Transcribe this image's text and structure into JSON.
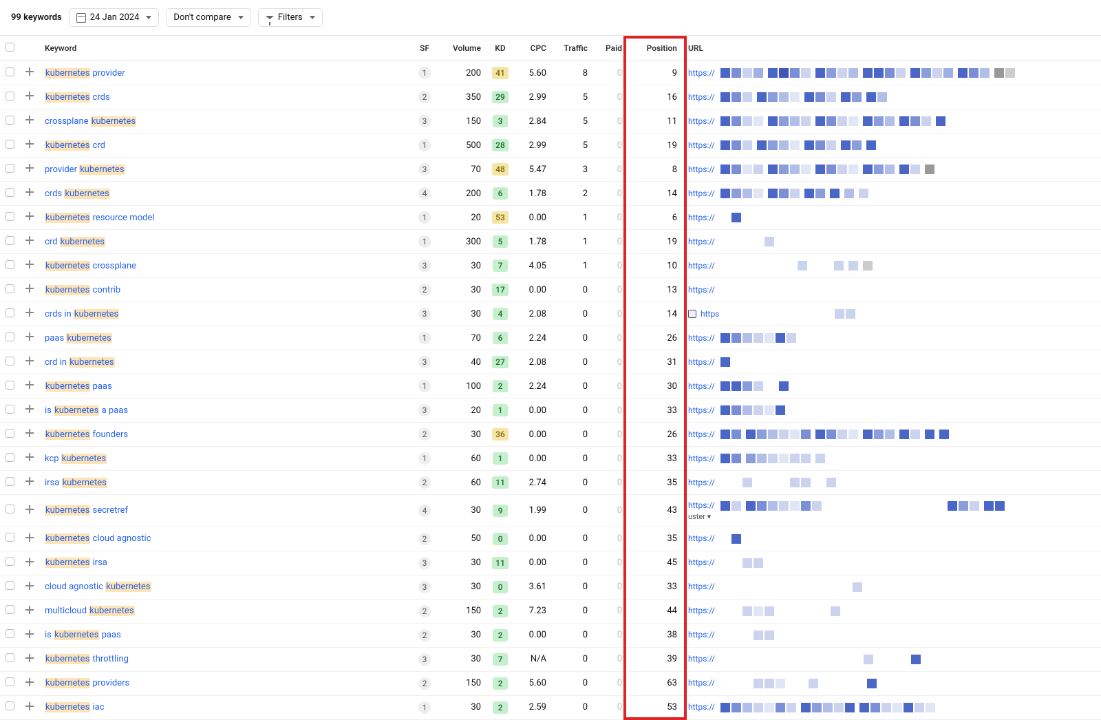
{
  "toolbar": {
    "count": "99 keywords",
    "date": "24 Jan 2024",
    "compare": "Don't compare",
    "filters": "Filters"
  },
  "headers": {
    "keyword": "Keyword",
    "sf": "SF",
    "volume": "Volume",
    "kd": "KD",
    "cpc": "CPC",
    "traffic": "Traffic",
    "paid": "Paid",
    "position": "Position",
    "url": "URL"
  },
  "highlight_term": "kubernetes",
  "rows": [
    {
      "kw": "kubernetes provider",
      "sf": 1,
      "volume": 200,
      "kd": 41,
      "cpc": "5.60",
      "traffic": 8,
      "paid": 0,
      "position": 9,
      "url": "https://",
      "blocks": [
        [
          "#4a66c7",
          "#7a8fd8",
          "#cbd3ef",
          "#9fb0e3"
        ],
        [
          "#4a66c7",
          "#3f57b8",
          "#7a8fd8",
          "#cbd3ef"
        ],
        [
          "#4a66c7",
          "#8b9ddd",
          "#cbd3ef",
          "#b1bfe8"
        ],
        [
          "#4a66c7",
          "#4a66c7",
          "#7a8fd8",
          "#cbd3ef"
        ],
        [
          "#4a66c7",
          "#8b9ddd",
          "#cbd3ef",
          "#9fb0e3"
        ],
        [
          "#4a66c7",
          "#7a8fd8",
          "#b1bfe8"
        ],
        [
          "#999",
          "#ccc"
        ]
      ]
    },
    {
      "kw": "kubernetes crds",
      "sf": 2,
      "volume": 350,
      "kd": 29,
      "cpc": "2.99",
      "traffic": 5,
      "paid": 0,
      "position": 16,
      "url": "https://",
      "blocks": [
        [
          "#4a66c7",
          "#7a8fd8",
          "#cbd3ef"
        ],
        [
          "#4a66c7",
          "#8b9ddd",
          "#b1bfe8",
          "#e1e6f6"
        ],
        [
          "#4a66c7",
          "#7a8fd8",
          "#cbd3ef"
        ],
        [
          "#4a66c7",
          "#8b9ddd"
        ],
        [
          "#4a66c7",
          "#b1bfe8"
        ]
      ]
    },
    {
      "kw": "crossplane kubernetes",
      "sf": 3,
      "volume": 150,
      "kd": 3,
      "cpc": "2.84",
      "traffic": 5,
      "paid": 0,
      "position": 11,
      "url": "https://",
      "blocks": [
        [
          "#4a66c7",
          "#7a8fd8",
          "#cbd3ef",
          "#e1e6f6"
        ],
        [
          "#4a66c7",
          "#8b9ddd",
          "#b1bfe8",
          "#cbd3ef"
        ],
        [
          "#4a66c7",
          "#7a8fd8",
          "#cbd3ef",
          "#e1e6f6"
        ],
        [
          "#4a66c7",
          "#8b9ddd",
          "#b1bfe8"
        ],
        [
          "#4a66c7",
          "#7a8fd8",
          "#cbd3ef"
        ],
        [
          "#4a66c7"
        ]
      ]
    },
    {
      "kw": "kubernetes crd",
      "sf": 1,
      "volume": 500,
      "kd": 28,
      "cpc": "2.99",
      "traffic": 5,
      "paid": 0,
      "position": 19,
      "url": "https://",
      "blocks": [
        [
          "#4a66c7",
          "#7a8fd8",
          "#cbd3ef"
        ],
        [
          "#4a66c7",
          "#8b9ddd",
          "#b1bfe8",
          "#e1e6f6"
        ],
        [
          "#4a66c7",
          "#7a8fd8",
          "#cbd3ef"
        ],
        [
          "#4a66c7",
          "#8b9ddd"
        ],
        [
          "#4a66c7"
        ]
      ]
    },
    {
      "kw": "provider kubernetes",
      "sf": 3,
      "volume": 70,
      "kd": 48,
      "cpc": "5.47",
      "traffic": 3,
      "paid": 0,
      "position": 8,
      "url": "https://",
      "blocks": [
        [
          "#4a66c7",
          "#7a8fd8",
          "#e1e6f6",
          "#cbd3ef"
        ],
        [
          "#4a66c7",
          "#8b9ddd",
          "#b1bfe8",
          "#e1e6f6"
        ],
        [
          "#4a66c7",
          "#7a8fd8",
          "#cbd3ef",
          "#e1e6f6"
        ],
        [
          "#4a66c7",
          "#8b9ddd",
          "#b1bfe8"
        ],
        [
          "#4a66c7",
          "#cbd3ef"
        ],
        [
          "#999"
        ]
      ]
    },
    {
      "kw": "crds kubernetes",
      "sf": 4,
      "volume": 200,
      "kd": 6,
      "cpc": "1.78",
      "traffic": 2,
      "paid": 0,
      "position": 14,
      "url": "https://",
      "blocks": [
        [
          "#4a66c7",
          "#8b9ddd",
          "#b1bfe8",
          "#e1e6f6"
        ],
        [
          "#4a66c7",
          "#7a8fd8",
          "#cbd3ef"
        ],
        [
          "#4a66c7",
          "#8b9ddd"
        ],
        [
          "#4a66c7"
        ],
        [
          "#b1bfe8"
        ],
        [
          "#cbd3ef"
        ]
      ]
    },
    {
      "kw": "kubernetes resource model",
      "sf": 1,
      "volume": 20,
      "kd": 53,
      "cpc": "0.00",
      "traffic": 1,
      "paid": 0,
      "position": 6,
      "url": "https://",
      "blocks": [
        [
          "",
          "#4a66c7"
        ]
      ]
    },
    {
      "kw": "crd kubernetes",
      "sf": 1,
      "volume": 300,
      "kd": 5,
      "cpc": "1.78",
      "traffic": 1,
      "paid": 0,
      "position": 19,
      "url": "https://",
      "blocks": [
        [
          "",
          "",
          "",
          "",
          "#cbd3ef"
        ]
      ]
    },
    {
      "kw": "kubernetes crossplane",
      "sf": 3,
      "volume": 30,
      "kd": 7,
      "cpc": "4.05",
      "traffic": 1,
      "paid": 0,
      "position": 10,
      "url": "https://",
      "blocks": [
        [
          "",
          "",
          "",
          "",
          "",
          "",
          "",
          "#cbd3ef"
        ],
        [
          "",
          "",
          "#cbd3ef"
        ],
        [
          "#cbd3ef"
        ],
        [
          "#ccc"
        ]
      ]
    },
    {
      "kw": "kubernetes contrib",
      "sf": 2,
      "volume": 30,
      "kd": 17,
      "cpc": "0.00",
      "traffic": 0,
      "paid": 0,
      "position": 13,
      "url": "https://",
      "blocks": []
    },
    {
      "kw": "crds in kubernetes",
      "sf": 3,
      "volume": 30,
      "kd": 4,
      "cpc": "2.08",
      "traffic": 0,
      "paid": 0,
      "position": 14,
      "url": "https",
      "ext_icon": true,
      "blocks": [
        [
          "",
          "",
          "",
          "",
          "",
          "",
          "",
          "",
          "",
          "",
          "#cbd3ef",
          "#cbd3ef"
        ]
      ]
    },
    {
      "kw": "paas kubernetes",
      "sf": 1,
      "volume": 70,
      "kd": 6,
      "cpc": "2.24",
      "traffic": 0,
      "paid": 0,
      "position": 26,
      "url": "https://",
      "blocks": [
        [
          "#4a66c7",
          "#7a8fd8",
          "#b1bfe8",
          "#cbd3ef",
          "#e1e6f6",
          "#4a66c7",
          "#cbd3ef"
        ]
      ]
    },
    {
      "kw": "crd in kubernetes",
      "sf": 3,
      "volume": 40,
      "kd": 27,
      "cpc": "2.08",
      "traffic": 0,
      "paid": 0,
      "position": 31,
      "url": "https://",
      "blocks": [
        [
          "#4a66c7"
        ]
      ]
    },
    {
      "kw": "kubernetes paas",
      "sf": 1,
      "volume": 100,
      "kd": 2,
      "cpc": "2.24",
      "traffic": 0,
      "paid": 0,
      "position": 30,
      "url": "https://",
      "blocks": [
        [
          "#4a66c7",
          "#4a66c7",
          "#8b9ddd",
          "#cbd3ef"
        ],
        [
          "",
          "#4a66c7"
        ]
      ]
    },
    {
      "kw": "is kubernetes a paas",
      "sf": 3,
      "volume": 20,
      "kd": 1,
      "cpc": "0.00",
      "traffic": 0,
      "paid": 0,
      "position": 33,
      "url": "https://",
      "blocks": [
        [
          "#4a66c7",
          "#7a8fd8",
          "#b1bfe8",
          "#cbd3ef",
          "#e1e6f6",
          "#4a66c7"
        ]
      ]
    },
    {
      "kw": "kubernetes founders",
      "sf": 2,
      "volume": 30,
      "kd": 36,
      "cpc": "0.00",
      "traffic": 0,
      "paid": 0,
      "position": 26,
      "url": "https://",
      "blocks": [
        [
          "#4a66c7",
          "#7a8fd8"
        ],
        [
          "#4a66c7",
          "#8b9ddd",
          "#b1bfe8",
          "#cbd3ef",
          "#e1e6f6",
          "#7a8fd8"
        ],
        [
          "#4a66c7",
          "#7a8fd8",
          "#cbd3ef",
          "#e1e6f6"
        ],
        [
          "#4a66c7",
          "#8b9ddd",
          "#b1bfe8"
        ],
        [
          "#4a66c7",
          "#cbd3ef"
        ],
        [
          "#4a66c7"
        ],
        [
          "#4a66c7"
        ]
      ]
    },
    {
      "kw": "kcp kubernetes",
      "sf": 1,
      "volume": 60,
      "kd": 1,
      "cpc": "0.00",
      "traffic": 0,
      "paid": 0,
      "position": 33,
      "url": "https://",
      "blocks": [
        [
          "#4a66c7",
          "#7a8fd8"
        ],
        [
          "#8b9ddd",
          "#b1bfe8",
          "#cbd3ef",
          "#e1e6f6",
          "#cbd3ef",
          "#cbd3ef"
        ],
        [
          "#cbd3ef"
        ]
      ]
    },
    {
      "kw": "irsa kubernetes",
      "sf": 2,
      "volume": 60,
      "kd": 11,
      "cpc": "2.74",
      "traffic": 0,
      "paid": 0,
      "position": 35,
      "url": "https://",
      "blocks": [
        [
          "",
          "",
          "#cbd3ef"
        ],
        [
          "",
          "",
          "",
          "#cbd3ef",
          "#cbd3ef"
        ],
        [
          "",
          "#cbd3ef"
        ]
      ]
    },
    {
      "kw": "kubernetes secretref",
      "sf": 4,
      "volume": 30,
      "kd": 9,
      "cpc": "1.99",
      "traffic": 0,
      "paid": 0,
      "position": 43,
      "url": "https://",
      "second": "uster ▾",
      "blocks": [
        [
          "#4a66c7",
          "#cbd3ef"
        ],
        [
          "#4a66c7",
          "#7a8fd8",
          "#b1bfe8",
          "#cbd3ef",
          "#e1e6f6",
          "#7a8fd8",
          "#cbd3ef"
        ],
        [
          "",
          "",
          "",
          "",
          "",
          "",
          "",
          "",
          "",
          "",
          "",
          "#4a66c7",
          "#8b9ddd",
          "#cbd3ef"
        ],
        [
          "#4a66c7",
          "#4a66c7"
        ]
      ]
    },
    {
      "kw": "kubernetes cloud agnostic",
      "sf": 2,
      "volume": 50,
      "kd": 0,
      "cpc": "0.00",
      "traffic": 0,
      "paid": 0,
      "position": 35,
      "url": "https://",
      "blocks": [
        [
          "",
          "#4a66c7"
        ]
      ]
    },
    {
      "kw": "kubernetes irsa",
      "sf": 3,
      "volume": 30,
      "kd": 11,
      "cpc": "0.00",
      "traffic": 0,
      "paid": 0,
      "position": 45,
      "url": "https://",
      "blocks": [
        [
          "",
          "",
          "#cbd3ef",
          "#cbd3ef"
        ]
      ]
    },
    {
      "kw": "cloud agnostic kubernetes",
      "sf": 3,
      "volume": 30,
      "kd": 0,
      "cpc": "3.61",
      "traffic": 0,
      "paid": 0,
      "position": 33,
      "url": "https://",
      "blocks": [
        [
          "",
          "",
          "",
          "",
          "",
          "",
          "",
          "",
          "",
          "",
          "",
          "",
          "#cbd3ef"
        ]
      ]
    },
    {
      "kw": "multicloud kubernetes",
      "sf": 2,
      "volume": 150,
      "kd": 2,
      "cpc": "7.23",
      "traffic": 0,
      "paid": 0,
      "position": 44,
      "url": "https://",
      "blocks": [
        [
          "",
          "",
          "#cbd3ef",
          "#e1e6f6",
          "#cbd3ef",
          "",
          "",
          "",
          "",
          "",
          "#cbd3ef"
        ]
      ]
    },
    {
      "kw": "is kubernetes paas",
      "sf": 2,
      "volume": 30,
      "kd": 2,
      "cpc": "0.00",
      "traffic": 0,
      "paid": 0,
      "position": 38,
      "url": "https://",
      "blocks": [
        [
          "",
          "",
          "",
          "#cbd3ef",
          "#cbd3ef"
        ]
      ]
    },
    {
      "kw": "kubernetes throttling",
      "sf": 3,
      "volume": 30,
      "kd": 7,
      "cpc": "N/A",
      "traffic": 0,
      "paid": 0,
      "position": 39,
      "url": "https://",
      "blocks": [
        [
          "",
          "",
          "",
          "",
          "",
          "",
          "",
          "",
          "",
          "",
          "",
          "",
          "",
          "#cbd3ef"
        ],
        [
          "",
          "",
          "",
          "#4a66c7"
        ]
      ]
    },
    {
      "kw": "kubernetes providers",
      "sf": 2,
      "volume": 150,
      "kd": 2,
      "cpc": "5.60",
      "traffic": 0,
      "paid": 0,
      "position": 63,
      "url": "https://",
      "blocks": [
        [
          "",
          "",
          "",
          "#cbd3ef",
          "#cbd3ef",
          "#e1e6f6",
          "",
          "",
          "#cbd3ef"
        ],
        [
          "",
          "",
          "",
          "",
          "#4a66c7"
        ]
      ]
    },
    {
      "kw": "kubernetes iac",
      "sf": 1,
      "volume": 30,
      "kd": 2,
      "cpc": "2.59",
      "traffic": 0,
      "paid": 0,
      "position": 53,
      "url": "https://",
      "blocks": [
        [
          "#4a66c7",
          "#7a8fd8",
          "#b1bfe8",
          "#cbd3ef",
          "#e1e6f6",
          "#7a8fd8",
          "#cbd3ef"
        ],
        [
          "#4a66c7",
          "#8b9ddd",
          "#b1bfe8",
          "#cbd3ef",
          "#4a66c7"
        ],
        [
          "#4a66c7",
          "#7a8fd8",
          "#cbd3ef",
          "#e1e6f6",
          "#4a66c7",
          "#cbd3ef",
          "#e1e6f6"
        ]
      ]
    }
  ]
}
